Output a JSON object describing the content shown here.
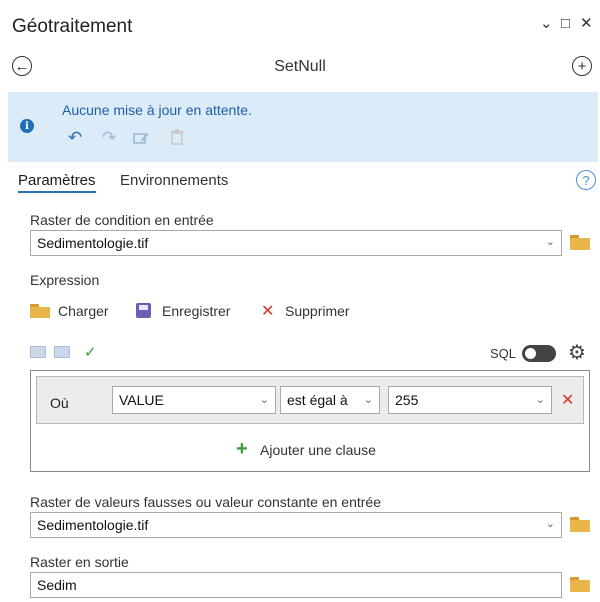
{
  "pane": {
    "title": "Géotraitement",
    "min_glyph": "⌄",
    "max_glyph": "□",
    "close_glyph": "✕"
  },
  "tool": {
    "name": "SetNull",
    "back_glyph": "←",
    "add_glyph": "+"
  },
  "banner": {
    "message": "Aucune mise à jour en attente.",
    "info_glyph": "i",
    "undo_glyph": "↶",
    "redo_glyph": "↷"
  },
  "tabs": {
    "parameters": "Paramètres",
    "environments": "Environnements",
    "help_glyph": "?"
  },
  "params": {
    "condition_label": "Raster de condition en entrée",
    "condition_value": "Sedimentologie.tif",
    "expression_label": "Expression",
    "load_label": "Charger",
    "save_label": "Enregistrer",
    "delete_label": "Supprimer",
    "sql_label": "SQL",
    "clause": {
      "where": "Où",
      "field": "VALUE",
      "operator": "est égal à",
      "value": "255"
    },
    "add_clause_label": "Ajouter une clause",
    "false_label": "Raster de valeurs fausses ou valeur constante en entrée",
    "false_value": "Sedimentologie.tif",
    "output_label": "Raster en sortie",
    "output_value": "Sedim"
  },
  "glyphs": {
    "dropdown": "⌄",
    "remove": "✕",
    "check": "✓",
    "plus": "+",
    "gear": "⚙"
  },
  "colors": {
    "accent": "#2b6fb6",
    "banner_bg": "#dcebf8",
    "folder": "#e7b54a",
    "remove_red": "#d9352b",
    "ok_green": "#3a9a3a",
    "save_purple": "#6a5fb5"
  }
}
